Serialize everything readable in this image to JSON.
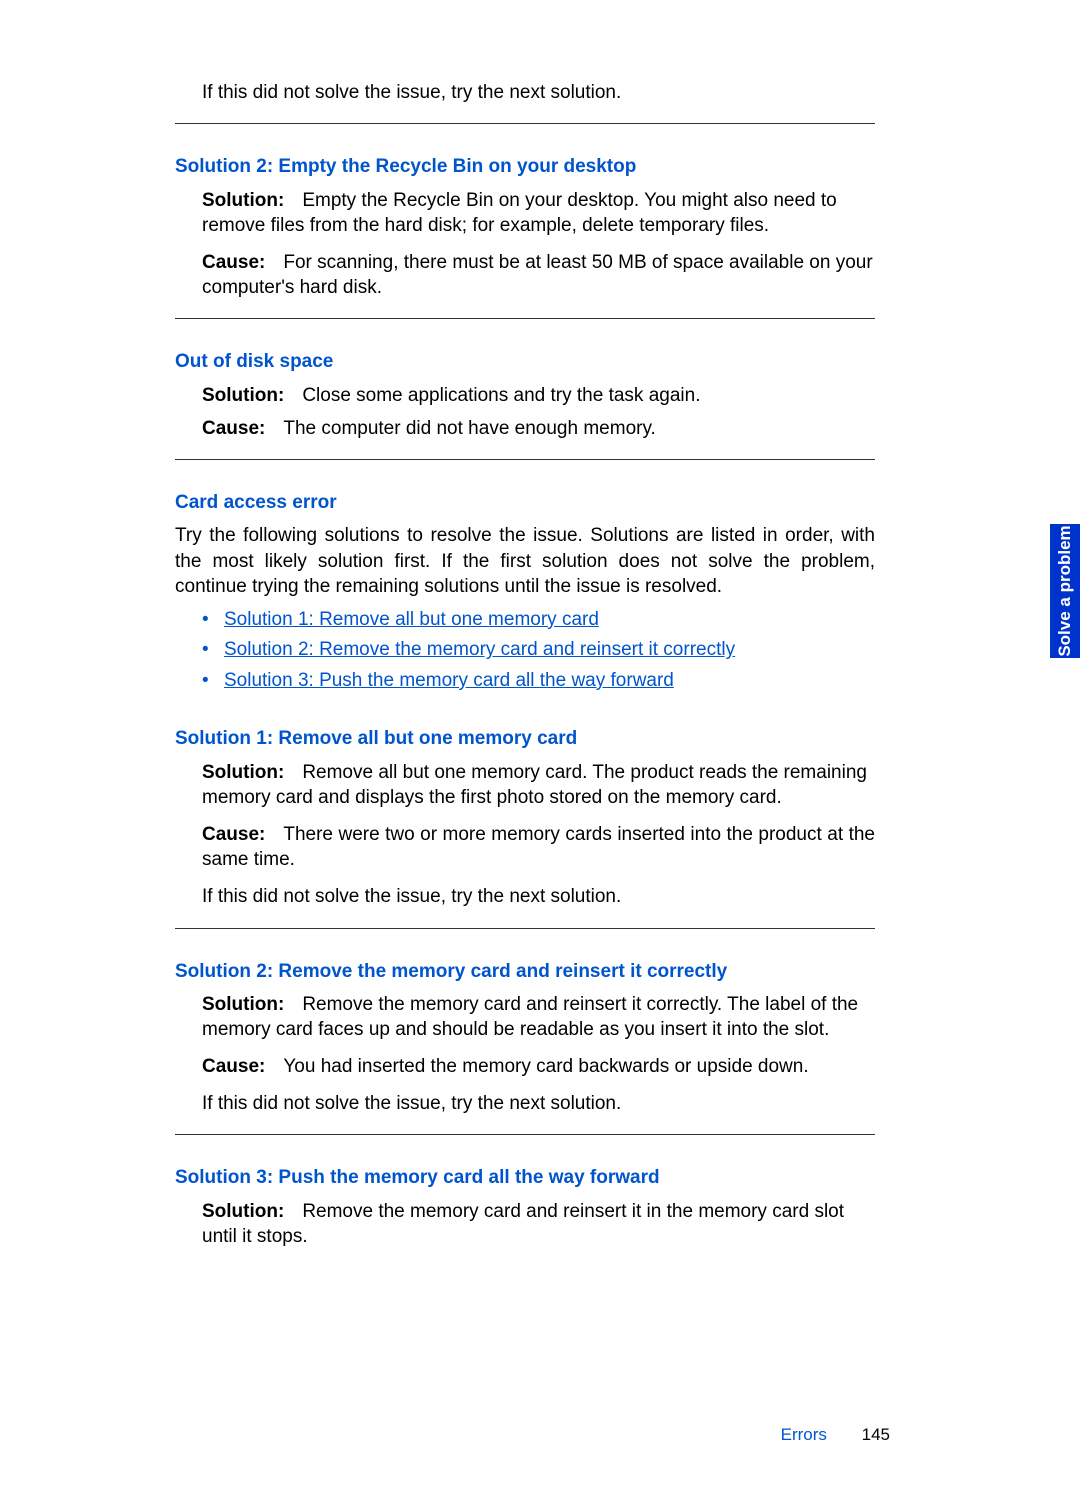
{
  "intro_continue": "If this did not solve the issue, try the next solution.",
  "sec_empty": {
    "heading": "Solution 2: Empty the Recycle Bin on your desktop",
    "sol_label": "Solution:",
    "sol_text": "Empty the Recycle Bin on your desktop. You might also need to remove files from the hard disk; for example, delete temporary files.",
    "cause_label": "Cause:",
    "cause_text": "For scanning, there must be at least 50 MB of space available on your computer's hard disk."
  },
  "sec_out": {
    "heading": "Out of disk space",
    "sol_label": "Solution:",
    "sol_text": "Close some applications and try the task again.",
    "cause_label": "Cause:",
    "cause_text": "The computer did not have enough memory."
  },
  "sec_card": {
    "heading": "Card access error",
    "intro": "Try the following solutions to resolve the issue. Solutions are listed in order, with the most likely solution first. If the first solution does not solve the problem, continue trying the remaining solutions until the issue is resolved.",
    "links": [
      "Solution 1: Remove all but one memory card",
      "Solution 2: Remove the memory card and reinsert it correctly",
      "Solution 3: Push the memory card all the way forward"
    ]
  },
  "sec_c1": {
    "heading": "Solution 1: Remove all but one memory card",
    "sol_label": "Solution:",
    "sol_text": "Remove all but one memory card. The product reads the remaining memory card and displays the first photo stored on the memory card.",
    "cause_label": "Cause:",
    "cause_text": "There were two or more memory cards inserted into the product at the same time.",
    "cont": "If this did not solve the issue, try the next solution."
  },
  "sec_c2": {
    "heading": "Solution 2: Remove the memory card and reinsert it correctly",
    "sol_label": "Solution:",
    "sol_text": "Remove the memory card and reinsert it correctly. The label of the memory card faces up and should be readable as you insert it into the slot.",
    "cause_label": "Cause:",
    "cause_text": "You had inserted the memory card backwards or upside down.",
    "cont": "If this did not solve the issue, try the next solution."
  },
  "sec_c3": {
    "heading": "Solution 3: Push the memory card all the way forward",
    "sol_label": "Solution:",
    "sol_text": "Remove the memory card and reinsert it in the memory card slot until it stops."
  },
  "side_tab": "Solve a problem",
  "footer_section": "Errors",
  "footer_page": "145"
}
